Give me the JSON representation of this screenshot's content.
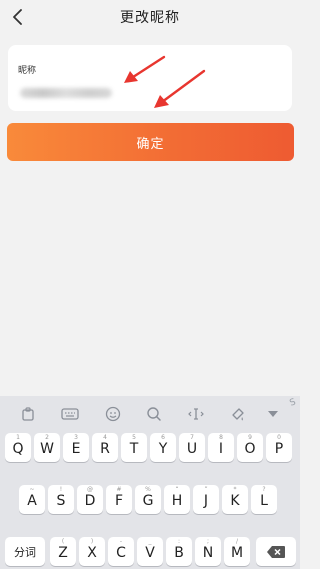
{
  "header": {
    "title": "更改昵称",
    "back_icon": "chevron-left-icon"
  },
  "form": {
    "label": "昵称",
    "value": "",
    "value_note": "blurred"
  },
  "confirm_label": "确定",
  "colors": {
    "accent_start": "#f98a3a",
    "accent_end": "#ee5b32",
    "annotation": "#e8362f"
  },
  "keyboard": {
    "toolbar_icons": [
      "clipboard-icon",
      "keyboard-icon",
      "emoji-icon",
      "search-icon",
      "cursor-move-icon",
      "theme-icon",
      "collapse-icon"
    ],
    "logo": "S",
    "row1": [
      {
        "hint": "1",
        "key": "Q"
      },
      {
        "hint": "2",
        "key": "W"
      },
      {
        "hint": "3",
        "key": "E"
      },
      {
        "hint": "4",
        "key": "R"
      },
      {
        "hint": "5",
        "key": "T"
      },
      {
        "hint": "6",
        "key": "Y"
      },
      {
        "hint": "7",
        "key": "U"
      },
      {
        "hint": "8",
        "key": "I"
      },
      {
        "hint": "9",
        "key": "O"
      },
      {
        "hint": "0",
        "key": "P"
      }
    ],
    "row2": [
      {
        "hint": "~",
        "key": "A"
      },
      {
        "hint": "!",
        "key": "S"
      },
      {
        "hint": "@",
        "key": "D"
      },
      {
        "hint": "#",
        "key": "F"
      },
      {
        "hint": "%",
        "key": "G"
      },
      {
        "hint": "“",
        "key": "H"
      },
      {
        "hint": "”",
        "key": "J"
      },
      {
        "hint": "*",
        "key": "K"
      },
      {
        "hint": "?",
        "key": "L"
      }
    ],
    "row3_left": "分词",
    "row3": [
      {
        "hint": "(",
        "key": "Z"
      },
      {
        "hint": ")",
        "key": "X"
      },
      {
        "hint": "-",
        "key": "C"
      },
      {
        "hint": "_",
        "key": "V"
      },
      {
        "hint": ":",
        "key": "B"
      },
      {
        "hint": ";",
        "key": "N"
      },
      {
        "hint": "/",
        "key": "M"
      }
    ],
    "backspace_icon": "backspace-icon"
  }
}
